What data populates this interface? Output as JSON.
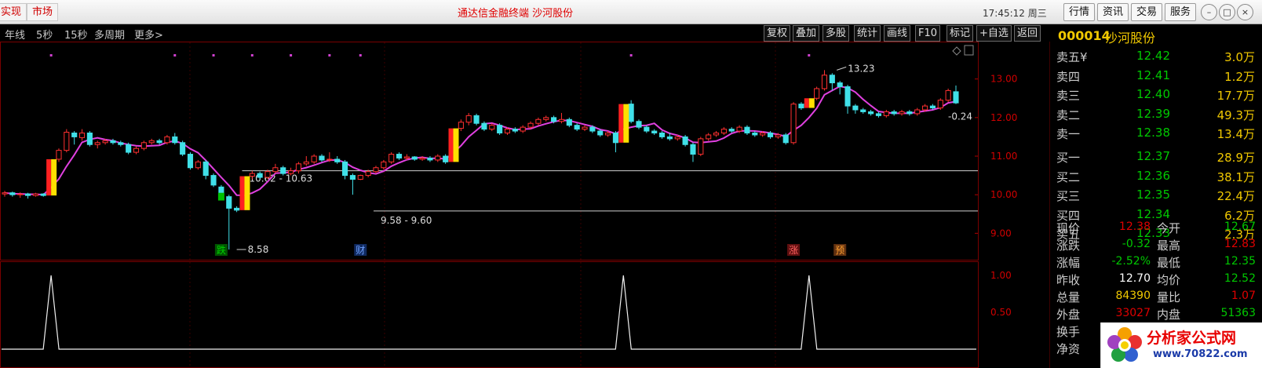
{
  "titlebar": {
    "tab_partial": "实现",
    "tab_market": "市场",
    "app_title": "通达信金融终端  沙河股份",
    "clock": "17:45:12 周三",
    "menu": [
      "行情",
      "资讯",
      "交易",
      "服务"
    ],
    "window_buttons": [
      "minimize-icon",
      "restore-icon",
      "close-icon"
    ]
  },
  "toolbar": {
    "periods": [
      "年线",
      "5秒",
      "15秒",
      "多周期",
      "更多>"
    ],
    "buttons": [
      "复权",
      "叠加",
      "多股",
      "统计",
      "画线",
      "F10",
      "标记",
      "+自选",
      "返回"
    ]
  },
  "quote": {
    "code": "000014",
    "name": "沙河股份",
    "asks": [
      {
        "label": "卖五",
        "mark": "¥",
        "price": "12.42",
        "vol": "3.0万"
      },
      {
        "label": "卖四",
        "mark": "",
        "price": "12.41",
        "vol": "1.2万"
      },
      {
        "label": "卖三",
        "mark": "",
        "price": "12.40",
        "vol": "17.7万"
      },
      {
        "label": "卖二",
        "mark": "",
        "price": "12.39",
        "vol": "49.3万"
      },
      {
        "label": "卖一",
        "mark": "",
        "price": "12.38",
        "vol": "13.4万"
      }
    ],
    "bids": [
      {
        "label": "买一",
        "price": "12.37",
        "vol": "28.9万"
      },
      {
        "label": "买二",
        "price": "12.36",
        "vol": "38.1万"
      },
      {
        "label": "买三",
        "price": "12.35",
        "vol": "22.4万"
      },
      {
        "label": "买四",
        "price": "12.34",
        "vol": "6.2万"
      },
      {
        "label": "买五",
        "price": "12.33",
        "vol": "2.3万"
      }
    ],
    "stats": [
      {
        "l1": "现价",
        "v1": "12.38",
        "c1": "#e00000",
        "l2": "今开",
        "v2": "12.67",
        "c2": "#00c800"
      },
      {
        "l1": "涨跌",
        "v1": "-0.32",
        "c1": "#00c800",
        "l2": "最高",
        "v2": "12.83",
        "c2": "#e00000"
      },
      {
        "l1": "涨幅",
        "v1": "-2.52%",
        "c1": "#00c800",
        "l2": "最低",
        "v2": "12.35",
        "c2": "#00c800"
      },
      {
        "l1": "昨收",
        "v1": "12.70",
        "c1": "#ffffff",
        "l2": "均价",
        "v2": "12.52",
        "c2": "#00c800"
      },
      {
        "l1": "总量",
        "v1": "84390",
        "c1": "#f0c800",
        "l2": "量比",
        "v2": "1.07",
        "c2": "#e00000"
      },
      {
        "l1": "外盘",
        "v1": "33027",
        "c1": "#e00000",
        "l2": "内盘",
        "v2": "51363",
        "c2": "#00c800"
      },
      {
        "l1": "换手",
        "v1": "",
        "c1": "#ccc",
        "l2": "",
        "v2": "",
        "c2": "#ccc"
      },
      {
        "l1": "净资",
        "v1": "",
        "c1": "#ccc",
        "l2": "",
        "v2": "",
        "c2": "#ccc"
      }
    ],
    "colors": {
      "up": "#e00000",
      "down": "#00c800",
      "neutral": "#ffffff",
      "volume": "#f0c800"
    }
  },
  "chart_data": {
    "type": "candlestick",
    "price_axis": {
      "ticks": [
        13.0,
        12.0,
        11.0,
        10.0,
        9.0
      ],
      "labels": [
        "13.00",
        "12.00",
        "11.00",
        "10.00",
        "9.00"
      ],
      "range": [
        8.6,
        13.4
      ]
    },
    "indicator_axis": {
      "ticks": [
        1.0,
        0.5
      ],
      "labels": [
        "1.00",
        "0.50"
      ],
      "range": [
        0,
        1
      ]
    },
    "support_lines": [
      {
        "value": 10.62,
        "label": "10.62 - 10.63"
      },
      {
        "value": 9.58,
        "label": "9.58 - 9.60"
      }
    ],
    "annotations": [
      {
        "label": "13.23",
        "value": 13.23
      },
      {
        "label": "8.58",
        "value": 8.58
      },
      {
        "label": "-0.24",
        "value": 12.35
      }
    ],
    "event_tags": [
      {
        "text": "跌",
        "color": "#00d000",
        "bg": "#005500"
      },
      {
        "text": "财",
        "color": "#6fa0ff",
        "bg": "#102a60"
      },
      {
        "text": "涨",
        "color": "#ff6060",
        "bg": "#601010"
      },
      {
        "text": "预",
        "color": "#ffa030",
        "bg": "#603010"
      }
    ],
    "indicator_spikes": [
      1,
      1,
      1
    ],
    "ma_color": "#e040e0",
    "signal_bar_colors": [
      "#ff2020",
      "#ffe000"
    ],
    "candles": [
      [
        10.02,
        10.05,
        9.95,
        10.1
      ],
      [
        10.05,
        10.0,
        9.95,
        10.08
      ],
      [
        10.0,
        10.02,
        9.92,
        10.06
      ],
      [
        10.02,
        9.98,
        9.9,
        10.05
      ],
      [
        9.98,
        10.02,
        9.95,
        10.05
      ],
      [
        10.02,
        9.98,
        9.95,
        10.04
      ],
      [
        9.98,
        10.92,
        9.98,
        10.95
      ],
      [
        10.92,
        11.15,
        10.85,
        11.2
      ],
      [
        11.15,
        11.62,
        11.1,
        11.7
      ],
      [
        11.6,
        11.5,
        11.3,
        11.65
      ],
      [
        11.48,
        11.6,
        11.4,
        11.7
      ],
      [
        11.6,
        11.3,
        11.25,
        11.65
      ],
      [
        11.3,
        11.35,
        11.2,
        11.4
      ],
      [
        11.35,
        11.4,
        11.3,
        11.45
      ],
      [
        11.4,
        11.35,
        11.3,
        11.45
      ],
      [
        11.35,
        11.3,
        11.25,
        11.4
      ],
      [
        11.3,
        11.1,
        11.05,
        11.35
      ],
      [
        11.1,
        11.2,
        11.05,
        11.25
      ],
      [
        11.2,
        11.35,
        11.15,
        11.4
      ],
      [
        11.35,
        11.4,
        11.3,
        11.45
      ],
      [
        11.4,
        11.35,
        11.3,
        11.45
      ],
      [
        11.35,
        11.5,
        11.3,
        11.55
      ],
      [
        11.5,
        11.35,
        11.3,
        11.6
      ],
      [
        11.35,
        11.05,
        11.0,
        11.4
      ],
      [
        11.05,
        10.7,
        10.65,
        11.1
      ],
      [
        10.7,
        10.85,
        10.65,
        10.9
      ],
      [
        10.85,
        10.5,
        10.4,
        10.9
      ],
      [
        10.5,
        10.25,
        10.2,
        10.55
      ],
      [
        10.2,
        9.95,
        9.9,
        10.25
      ],
      [
        9.95,
        9.65,
        8.58,
        10.0
      ],
      [
        9.65,
        9.6,
        9.55,
        9.7
      ],
      [
        9.6,
        10.48,
        9.58,
        10.5
      ],
      [
        10.48,
        10.55,
        10.4,
        10.62
      ],
      [
        10.55,
        10.45,
        10.4,
        10.6
      ],
      [
        10.45,
        10.6,
        10.4,
        10.65
      ],
      [
        10.6,
        10.7,
        10.55,
        10.8
      ],
      [
        10.7,
        10.55,
        10.5,
        10.75
      ],
      [
        10.55,
        10.62,
        10.5,
        10.7
      ],
      [
        10.62,
        10.8,
        10.55,
        10.85
      ],
      [
        10.8,
        10.85,
        10.75,
        11.0
      ],
      [
        10.85,
        11.0,
        10.8,
        11.05
      ],
      [
        11.0,
        10.9,
        10.85,
        11.05
      ],
      [
        10.9,
        10.92,
        10.85,
        11.1
      ],
      [
        10.92,
        10.85,
        10.8,
        11.0
      ],
      [
        10.85,
        10.5,
        10.4,
        10.9
      ],
      [
        10.5,
        10.4,
        10.0,
        10.55
      ],
      [
        10.4,
        10.5,
        10.38,
        10.52
      ],
      [
        10.5,
        10.6,
        10.45,
        10.65
      ],
      [
        10.6,
        10.7,
        10.55,
        10.75
      ],
      [
        10.7,
        10.85,
        10.65,
        10.9
      ],
      [
        10.85,
        11.05,
        10.8,
        11.1
      ],
      [
        11.05,
        10.95,
        10.9,
        11.1
      ],
      [
        10.95,
        10.98,
        10.9,
        11.05
      ],
      [
        10.98,
        10.92,
        10.88,
        11.0
      ],
      [
        10.92,
        10.95,
        10.88,
        11.0
      ],
      [
        10.95,
        10.9,
        10.85,
        11.0
      ],
      [
        10.9,
        11.0,
        10.85,
        11.05
      ],
      [
        11.0,
        10.85,
        10.8,
        11.05
      ],
      [
        10.85,
        11.72,
        10.85,
        11.75
      ],
      [
        11.72,
        11.88,
        11.65,
        11.95
      ],
      [
        11.88,
        12.05,
        11.8,
        12.12
      ],
      [
        12.05,
        11.85,
        11.8,
        12.1
      ],
      [
        11.85,
        11.7,
        11.65,
        11.9
      ],
      [
        11.7,
        11.8,
        11.65,
        11.85
      ],
      [
        11.8,
        11.6,
        11.55,
        11.85
      ],
      [
        11.6,
        11.7,
        11.55,
        11.75
      ],
      [
        11.7,
        11.65,
        11.6,
        11.75
      ],
      [
        11.65,
        11.75,
        11.6,
        11.8
      ],
      [
        11.75,
        11.85,
        11.7,
        11.9
      ],
      [
        11.85,
        11.95,
        11.8,
        12.0
      ],
      [
        11.95,
        12.0,
        11.9,
        12.05
      ],
      [
        12.0,
        11.9,
        11.85,
        12.05
      ],
      [
        11.9,
        11.95,
        11.85,
        12.12
      ],
      [
        11.95,
        11.8,
        11.75,
        12.0
      ],
      [
        11.8,
        11.7,
        11.65,
        11.85
      ],
      [
        11.7,
        11.75,
        11.65,
        11.8
      ],
      [
        11.75,
        11.65,
        11.6,
        11.8
      ],
      [
        11.65,
        11.55,
        11.5,
        11.7
      ],
      [
        11.55,
        11.6,
        11.5,
        11.65
      ],
      [
        11.6,
        11.35,
        11.1,
        11.65
      ],
      [
        11.35,
        12.35,
        11.3,
        12.4
      ],
      [
        12.35,
        11.9,
        11.85,
        12.45
      ],
      [
        11.9,
        11.75,
        11.7,
        11.95
      ],
      [
        11.75,
        11.65,
        11.6,
        11.8
      ],
      [
        11.65,
        11.6,
        11.55,
        11.7
      ],
      [
        11.6,
        11.5,
        11.45,
        11.65
      ],
      [
        11.5,
        11.45,
        11.4,
        11.6
      ],
      [
        11.45,
        11.5,
        11.4,
        11.55
      ],
      [
        11.5,
        11.3,
        11.25,
        11.55
      ],
      [
        11.3,
        11.05,
        10.85,
        11.35
      ],
      [
        11.05,
        11.45,
        11.0,
        11.5
      ],
      [
        11.45,
        11.55,
        11.4,
        11.6
      ],
      [
        11.55,
        11.6,
        11.5,
        11.65
      ],
      [
        11.6,
        11.7,
        11.55,
        11.75
      ],
      [
        11.7,
        11.65,
        11.6,
        11.75
      ],
      [
        11.65,
        11.75,
        11.6,
        11.8
      ],
      [
        11.75,
        11.6,
        11.55,
        11.8
      ],
      [
        11.6,
        11.55,
        11.5,
        11.65
      ],
      [
        11.55,
        11.6,
        11.5,
        11.65
      ],
      [
        11.6,
        11.5,
        11.45,
        11.65
      ],
      [
        11.5,
        11.55,
        11.45,
        11.6
      ],
      [
        11.55,
        11.35,
        11.3,
        11.6
      ],
      [
        11.35,
        12.35,
        11.3,
        12.4
      ],
      [
        12.35,
        12.25,
        12.2,
        12.4
      ],
      [
        12.25,
        12.5,
        12.2,
        12.55
      ],
      [
        12.5,
        12.75,
        12.45,
        12.8
      ],
      [
        12.75,
        13.1,
        12.7,
        13.23
      ],
      [
        13.1,
        12.9,
        12.7,
        13.15
      ],
      [
        12.9,
        12.8,
        12.6,
        12.95
      ],
      [
        12.8,
        12.3,
        12.1,
        12.85
      ],
      [
        12.3,
        12.2,
        12.1,
        12.35
      ],
      [
        12.2,
        12.15,
        12.1,
        12.25
      ],
      [
        12.15,
        12.1,
        12.05,
        12.2
      ],
      [
        12.1,
        12.05,
        12.0,
        12.15
      ],
      [
        12.05,
        12.15,
        12.0,
        12.2
      ],
      [
        12.15,
        12.1,
        12.05,
        12.2
      ],
      [
        12.1,
        12.15,
        12.05,
        12.2
      ],
      [
        12.15,
        12.1,
        12.05,
        12.2
      ],
      [
        12.1,
        12.2,
        12.05,
        12.25
      ],
      [
        12.2,
        12.3,
        12.15,
        12.35
      ],
      [
        12.3,
        12.25,
        12.2,
        12.35
      ],
      [
        12.25,
        12.45,
        12.2,
        12.5
      ],
      [
        12.45,
        12.7,
        12.4,
        12.75
      ],
      [
        12.67,
        12.38,
        12.35,
        12.83
      ]
    ],
    "signal_idx": [
      6,
      31,
      58,
      80,
      104
    ],
    "spike_idx": [
      6,
      80,
      104
    ],
    "event_idx": [
      28,
      46,
      102,
      108
    ],
    "high_label_idx": 108,
    "low_label_idx": 30,
    "support_label_idx": [
      31,
      48
    ],
    "dot_idx": [
      6,
      22,
      27,
      32,
      37,
      42,
      46,
      81,
      104
    ]
  }
}
